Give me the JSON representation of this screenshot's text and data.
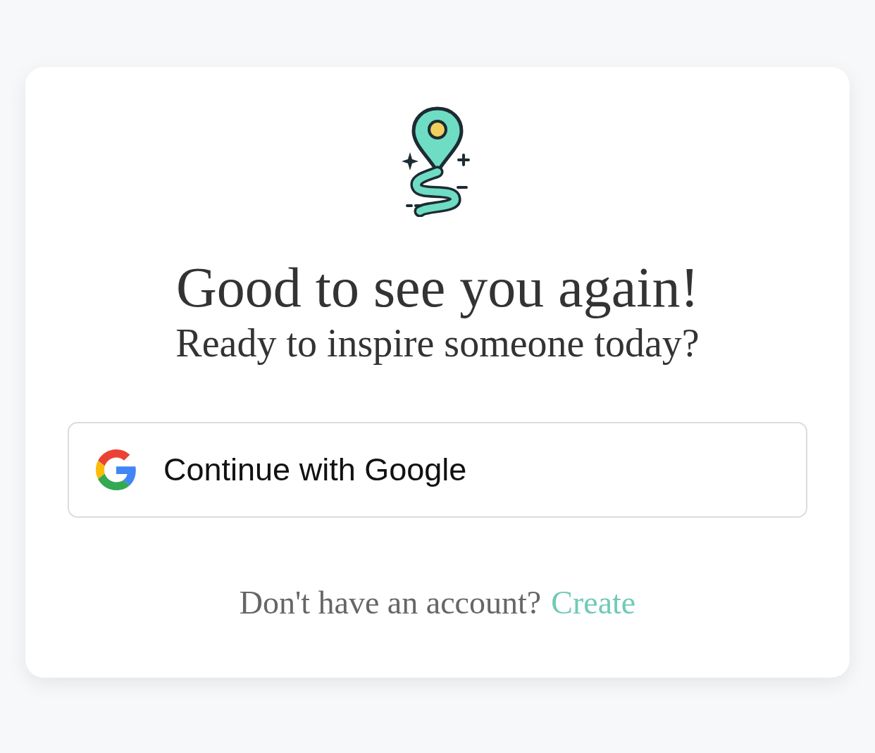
{
  "heading": "Good to see you again!",
  "subheading": "Ready to inspire someone today?",
  "google_button": {
    "label": "Continue with Google"
  },
  "footer": {
    "prompt": "Don't have an account?",
    "link": "Create"
  }
}
